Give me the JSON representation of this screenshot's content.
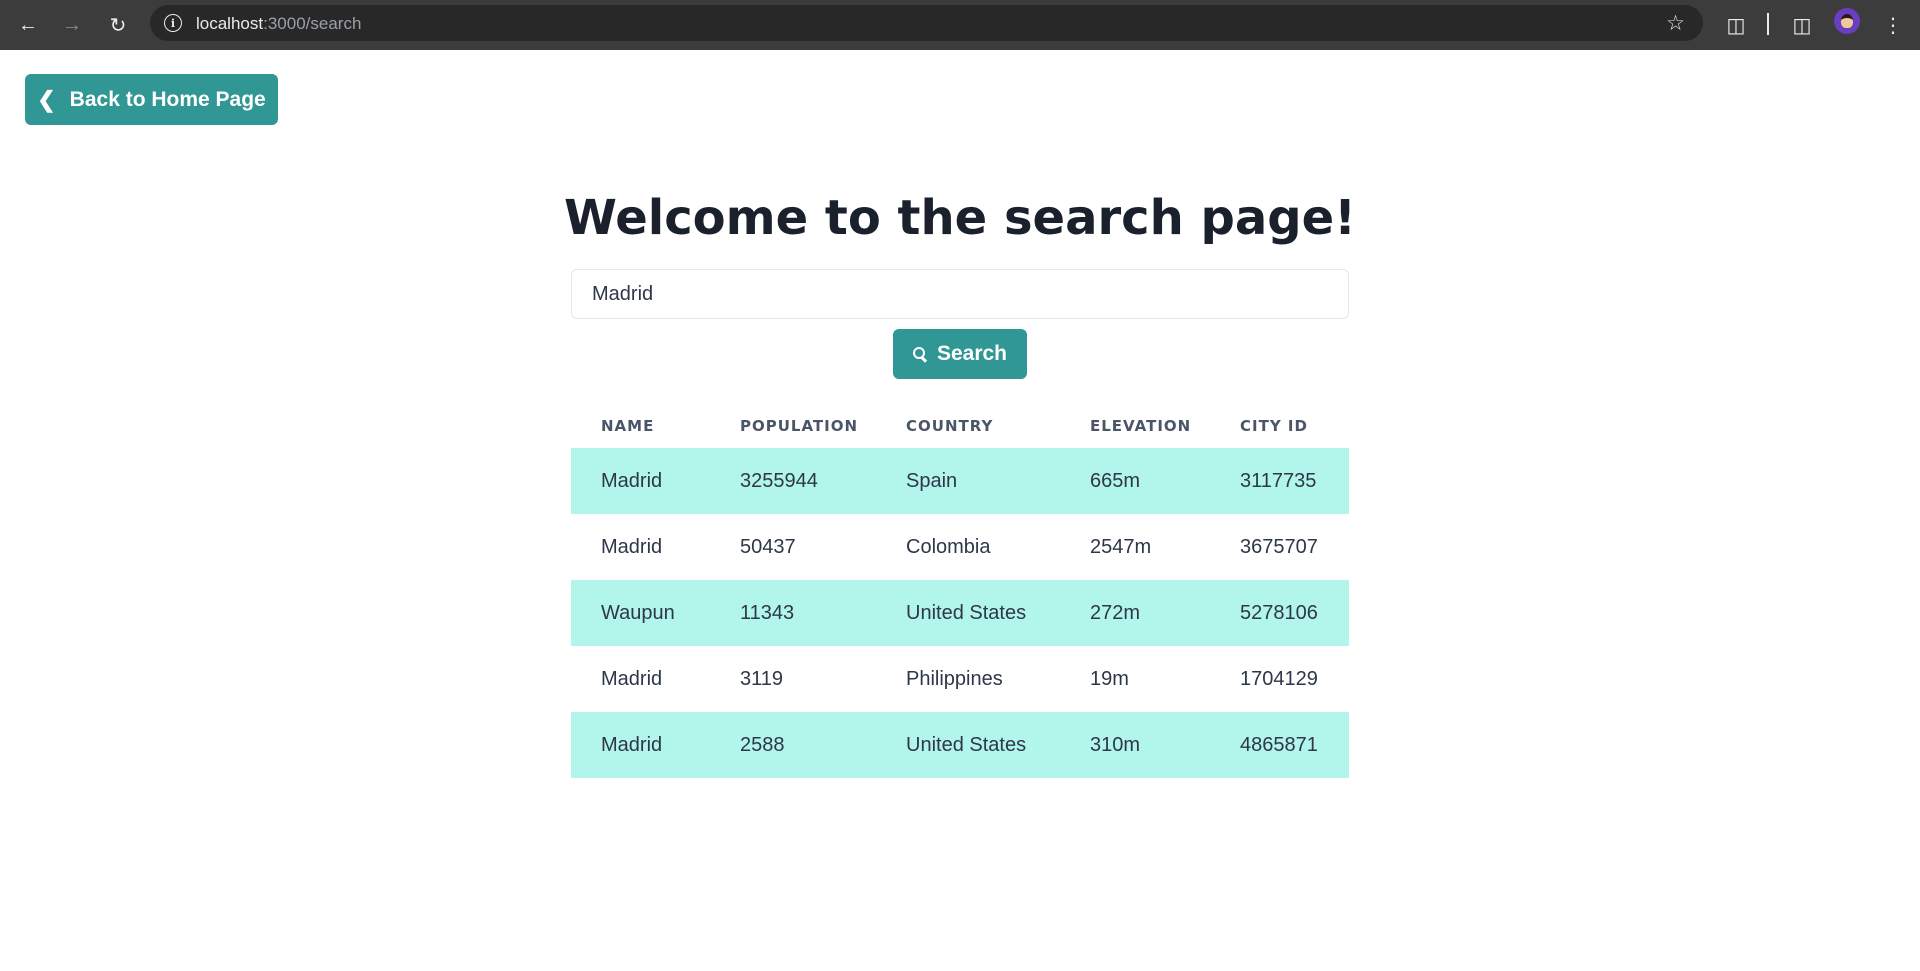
{
  "browser": {
    "url_host": "localhost",
    "url_path": ":3000/search"
  },
  "back_button": {
    "label": "Back to Home Page"
  },
  "page": {
    "title": "Welcome to the search page!"
  },
  "search": {
    "value": "Madrid",
    "button_label": "Search"
  },
  "table": {
    "headers": [
      "NAME",
      "POPULATION",
      "COUNTRY",
      "ELEVATION",
      "CITY ID"
    ],
    "rows": [
      [
        "Madrid",
        "3255944",
        "Spain",
        "665m",
        "3117735"
      ],
      [
        "Madrid",
        "50437",
        "Colombia",
        "2547m",
        "3675707"
      ],
      [
        "Waupun",
        "11343",
        "United States",
        "272m",
        "5278106"
      ],
      [
        "Madrid",
        "3119",
        "Philippines",
        "19m",
        "1704129"
      ],
      [
        "Madrid",
        "2588",
        "United States",
        "310m",
        "4865871"
      ]
    ]
  },
  "colors": {
    "accent": "#319795",
    "row_stripe": "#b2f5ea",
    "title": "#1a202c"
  }
}
